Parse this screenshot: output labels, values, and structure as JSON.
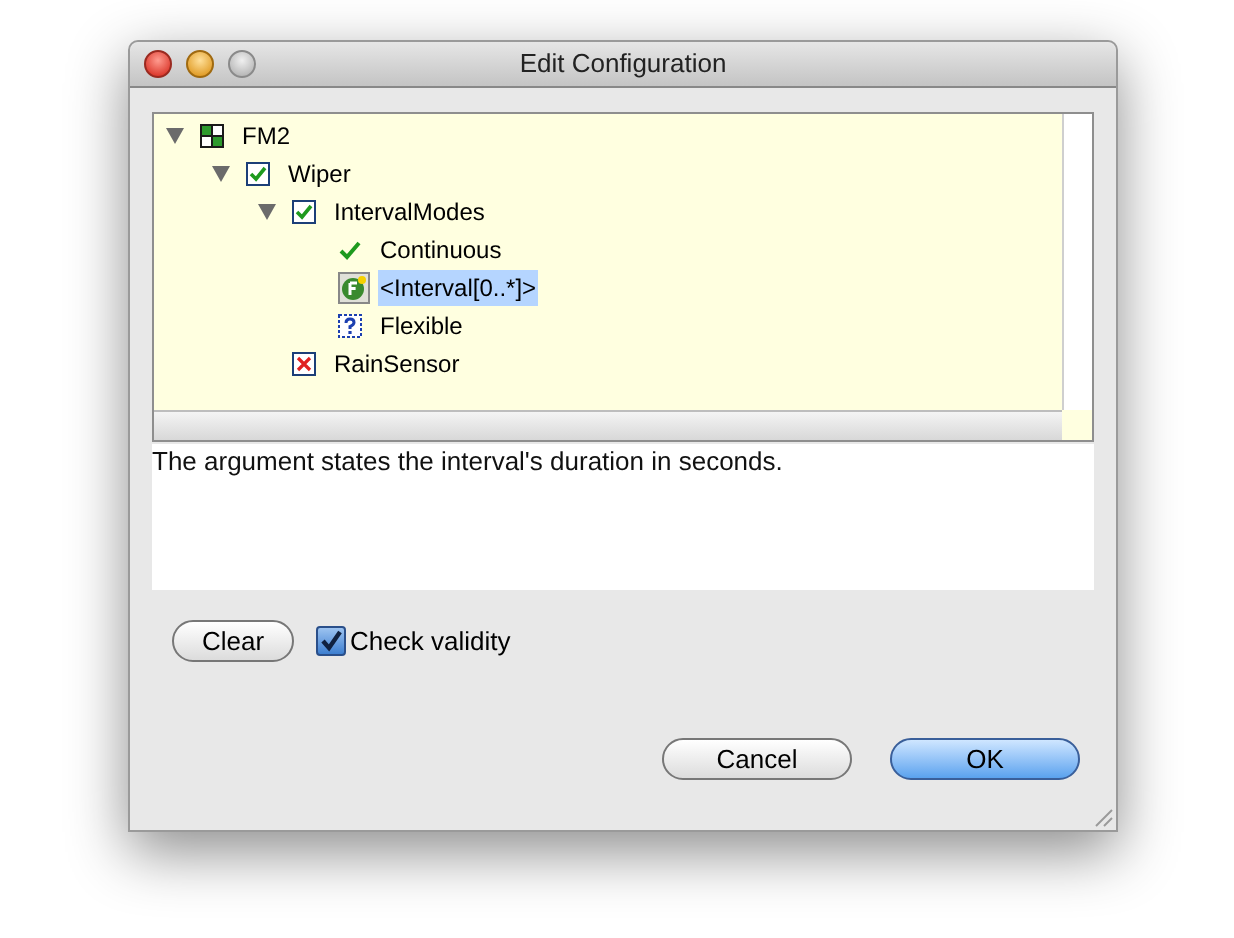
{
  "window": {
    "title": "Edit Configuration"
  },
  "tree": [
    {
      "label": "FM2",
      "kind": "feature",
      "expanded": true,
      "selected": false,
      "children": [
        {
          "label": "Wiper",
          "kind": "checked",
          "expanded": true,
          "selected": false,
          "children": [
            {
              "label": "IntervalModes",
              "kind": "checked",
              "expanded": true,
              "selected": false,
              "children": [
                {
                  "label": "Continuous",
                  "kind": "tick",
                  "selected": false
                },
                {
                  "label": "<Interval[0..*]>",
                  "kind": "argument",
                  "selected": true
                },
                {
                  "label": "Flexible",
                  "kind": "unknown",
                  "selected": false
                }
              ]
            },
            {
              "label": "RainSensor",
              "kind": "excluded",
              "selected": false
            }
          ]
        }
      ]
    }
  ],
  "description": "The argument states the interval's duration in seconds.",
  "clear_button": "Clear",
  "check_validity": {
    "label": "Check validity",
    "checked": true
  },
  "buttons": [
    {
      "label": "Cancel",
      "default": false
    },
    {
      "label": "OK",
      "default": true
    }
  ]
}
